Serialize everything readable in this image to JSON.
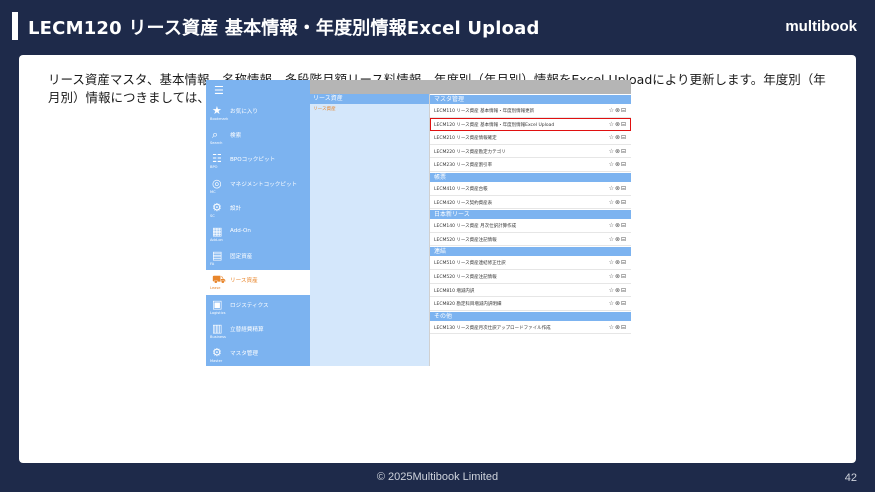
{
  "slide": {
    "title": "LECM120 リース資産 基本情報・年度別情報Excel Upload",
    "brand": "multibook",
    "description": "リース資産マスタ、基本情報、名称情報、多段階月額リース料情報、年度別（年月別）情報をExcel Uploadにより更新します。年度別（年月別）情報につきましては、基本情報に基づいて、完全自動作成も可能です。",
    "footer": "© 2025Multibook Limited",
    "page_number": "42"
  },
  "app": {
    "sidebar": [
      {
        "icon": "★",
        "icon_name": "star-icon",
        "label": "お気に入り",
        "sub": "Bookmark",
        "active": false
      },
      {
        "icon": "⌕",
        "icon_name": "search-icon",
        "label": "検索",
        "sub": "Search",
        "active": false
      },
      {
        "icon": "☷",
        "icon_name": "bpo-icon",
        "label": "BPOコックピット",
        "sub": "BPO",
        "active": false
      },
      {
        "icon": "◎",
        "icon_name": "management-icon",
        "label": "マネジメントコックピット",
        "sub": "MC",
        "active": false
      },
      {
        "icon": "⚙",
        "icon_name": "settings-icon",
        "label": "設計",
        "sub": "SC",
        "active": false
      },
      {
        "icon": "▦",
        "icon_name": "addon-icon",
        "label": "Add-On",
        "sub": "Add-on",
        "active": false
      },
      {
        "icon": "▤",
        "icon_name": "fixed-asset-icon",
        "label": "固定資産",
        "sub": "FA",
        "active": false
      },
      {
        "icon": "⛟",
        "icon_name": "lease-asset-icon",
        "label": "リース資産",
        "sub": "Lease",
        "active": true
      },
      {
        "icon": "▣",
        "icon_name": "logistics-icon",
        "label": "ロジスティクス",
        "sub": "Logistics",
        "active": false
      },
      {
        "icon": "▥",
        "icon_name": "expense-icon",
        "label": "立替経費精算",
        "sub": "Business",
        "active": false
      },
      {
        "icon": "⚙",
        "icon_name": "master-icon",
        "label": "マスタ管理",
        "sub": "Master",
        "active": false
      }
    ],
    "middle": {
      "header": "リース資産",
      "items": [
        "リース資産"
      ]
    },
    "groups": [
      {
        "name": "マスタ管理",
        "rows": [
          {
            "text": "LECM110 リース資産 基本情報・年度別情報更新",
            "hl": false
          },
          {
            "text": "LECM120 リース資産 基本情報・年度別情報Excel Upload",
            "hl": true
          },
          {
            "text": "LECM210 リース資産情報確定",
            "hl": false
          },
          {
            "text": "LECM220 リース資産勘定カテゴリ",
            "hl": false
          },
          {
            "text": "LECM230 リース資産割引率",
            "hl": false
          }
        ]
      },
      {
        "name": "帳票",
        "rows": [
          {
            "text": "LECM410 リース資産台帳",
            "hl": false
          },
          {
            "text": "LECM420 リース契約資産表",
            "hl": false
          }
        ]
      },
      {
        "name": "日本新リース",
        "rows": [
          {
            "text": "LECM140 リース資産 月次仕訳計算作成",
            "hl": false
          },
          {
            "text": "LECM520 リース資産注記情報",
            "hl": false
          }
        ]
      },
      {
        "name": "連結",
        "rows": [
          {
            "text": "LECM510 リース資産連結修正仕訳",
            "hl": false
          },
          {
            "text": "LECM520 リース資産注記情報",
            "hl": false
          },
          {
            "text": "LECM810 増減内訳",
            "hl": false
          },
          {
            "text": "LECM820 勘定科目増減内訳明細",
            "hl": false
          }
        ]
      },
      {
        "name": "その他",
        "rows": [
          {
            "text": "LECM130 リース資産月次仕訳アップロードファイル作成",
            "hl": false
          }
        ]
      }
    ],
    "row_actions": "☆⊗⊟"
  },
  "colors": {
    "background": "#1e2a4a",
    "sidebar": "#7cb3f0",
    "accent": "#e8862c",
    "highlight": "#e01010"
  }
}
